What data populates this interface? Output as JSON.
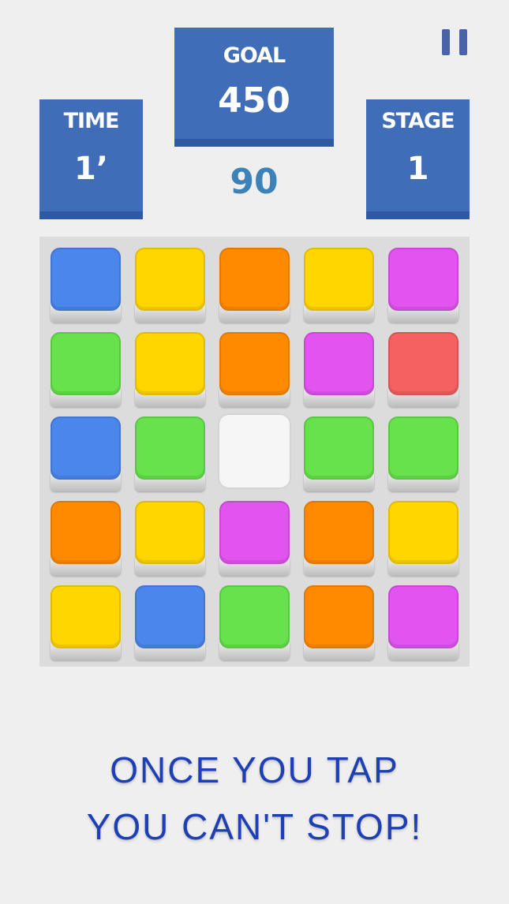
{
  "hud": {
    "time": {
      "label": "TIME",
      "value": "1’"
    },
    "goal": {
      "label": "GOAL",
      "value": "450"
    },
    "stage": {
      "label": "STAGE",
      "value": "1"
    },
    "score": "90",
    "pause_icon": "pause-icon"
  },
  "board": {
    "rows": 5,
    "cols": 5,
    "tiles": [
      [
        "blue",
        "yellow",
        "orange",
        "yellow",
        "magenta"
      ],
      [
        "green",
        "yellow",
        "orange",
        "magenta",
        "red"
      ],
      [
        "blue",
        "green",
        "empty",
        "green",
        "green"
      ],
      [
        "orange",
        "yellow",
        "magenta",
        "orange",
        "yellow"
      ],
      [
        "yellow",
        "blue",
        "green",
        "orange",
        "magenta"
      ]
    ]
  },
  "colors": {
    "blue": "#4b86ec",
    "yellow": "#ffd600",
    "orange": "#ff8a00",
    "magenta": "#e254ef",
    "green": "#67e24d",
    "red": "#f56060",
    "hud_box": "#3f6db7",
    "score_text": "#3c82b8",
    "tagline_text": "#1f3fb5"
  },
  "tagline": {
    "line1": "ONCE YOU TAP",
    "line2": "YOU CAN'T STOP!"
  }
}
